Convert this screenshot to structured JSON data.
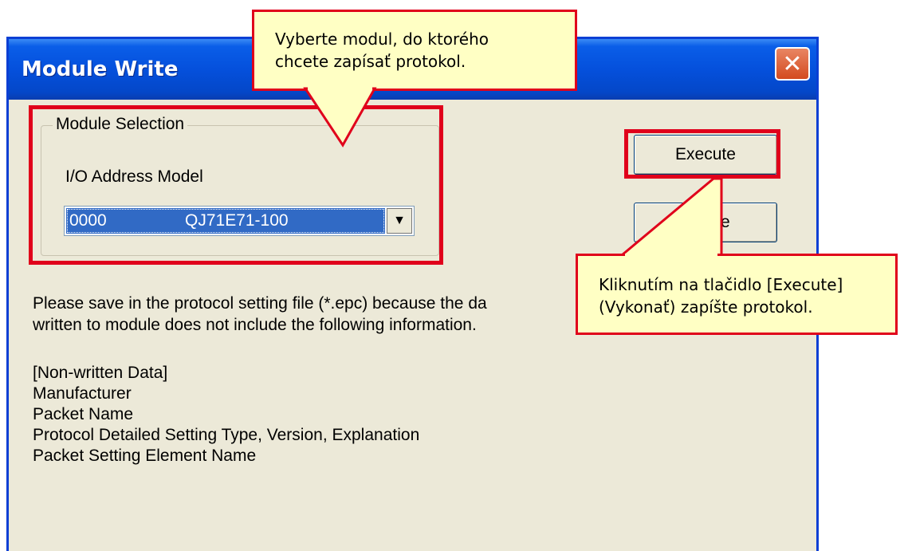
{
  "window": {
    "title": "Module Write",
    "close_glyph": "✕"
  },
  "module_selection": {
    "legend": "Module Selection",
    "field_label": "I/O Address Model",
    "selected_address": "0000",
    "selected_model": "QJ71E71-100",
    "dropdown_arrow": "▼"
  },
  "buttons": {
    "execute": "Execute",
    "close_partial": "e"
  },
  "message": {
    "line1": "Please save in the protocol setting file (*.epc) because the da",
    "line2": "written to module does not include the following information."
  },
  "non_written": {
    "header": "[Non-written Data]",
    "items": [
      "Manufacturer",
      "Packet Name",
      "Protocol Detailed Setting Type, Version, Explanation",
      "Packet Setting Element Name"
    ]
  },
  "callouts": {
    "top": {
      "line1": "Vyberte modul, do ktorého",
      "line2": "chcete zapísať protokol."
    },
    "right": {
      "line1": "Kliknutím na tlačidlo [Execute]",
      "line2": "(Vykonať) zapíšte protokol."
    }
  },
  "colors": {
    "titlebar": "#0550dc",
    "highlight": "#e0001b",
    "callout_bg": "#ffffc4",
    "selection": "#316ac5"
  }
}
